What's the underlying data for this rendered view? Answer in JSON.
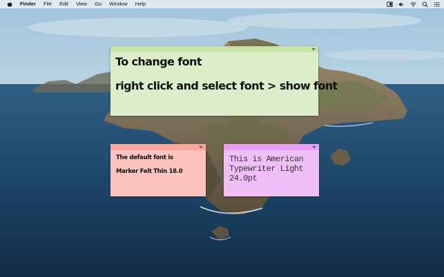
{
  "menubar": {
    "apple_icon": "apple-logo-icon",
    "app_name": "Finder",
    "menus": [
      "File",
      "Edit",
      "View",
      "Go",
      "Window",
      "Help"
    ],
    "status_icons": [
      "display-icon",
      "volume-icon",
      "wifi-icon",
      "search-icon",
      "list-icon"
    ]
  },
  "notes": {
    "green": {
      "color": "#dceec9",
      "title_color": "#c7e2a6",
      "lines": [
        "To change font",
        "right click and select font > show font"
      ]
    },
    "red": {
      "color": "#fcc4bd",
      "title_color": "#f7a79c",
      "lines": [
        "The default font is",
        "Marker Felt Thin 18.0"
      ]
    },
    "purple": {
      "color": "#f0bff8",
      "title_color": "#e79ef4",
      "text": "This is American Typewriter Light 24.0pt"
    }
  }
}
